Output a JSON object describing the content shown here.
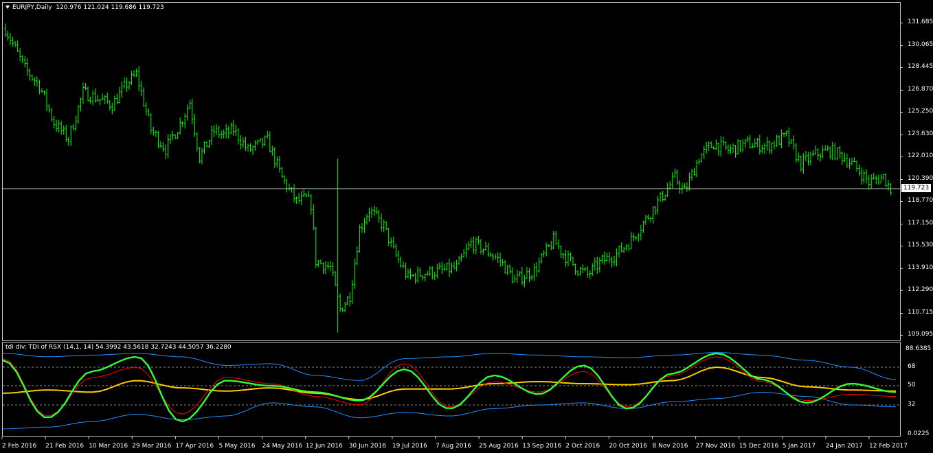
{
  "main_chart": {
    "header": {
      "symbol": "EURJPY,Daily",
      "ohlc": "120.976 121.024 119.686 119.723"
    },
    "current_price": "119.723",
    "price_axis": [
      "131.685",
      "130.065",
      "128.445",
      "126.870",
      "125.250",
      "123.630",
      "122.010",
      "120.390",
      "118.770",
      "117.150",
      "115.530",
      "113.910",
      "112.290",
      "110.715",
      "109.095"
    ],
    "bar_color": "#00ff00",
    "current_line_color": "#98b49a"
  },
  "indicator": {
    "header": "tdi div: TDI of RSX (14,1, 14) 54.3992 43.5618 32.7243 44.5057 36.2280",
    "axis": [
      "88.6385",
      "68",
      "50",
      "32",
      "0.0225"
    ],
    "colors": {
      "bands": "#1e90ff",
      "signal": "#ff0000",
      "rsx": "#32ff32",
      "midline": "#ffcc00"
    }
  },
  "time_axis": [
    "2 Feb 2016",
    "21 Feb 2016",
    "10 Mar 2016",
    "29 Mar 2016",
    "17 Apr 2016",
    "5 May 2016",
    "24 May 2016",
    "12 Jun 2016",
    "30 Jun 2016",
    "19 Jul 2016",
    "7 Aug 2016",
    "25 Aug 2016",
    "13 Sep 2016",
    "2 Oct 2016",
    "20 Oct 2016",
    "8 Nov 2016",
    "27 Nov 2016",
    "15 Dec 2016",
    "5 Jan 2017",
    "24 Jan 2017",
    "12 Feb 2017"
  ],
  "chart_data": [
    {
      "type": "line",
      "title": "EURJPY,Daily",
      "subtitle": "120.976 121.024 119.686 119.723",
      "x": [
        "2 Feb 2016",
        "21 Feb 2016",
        "10 Mar 2016",
        "29 Mar 2016",
        "17 Apr 2016",
        "5 May 2016",
        "24 May 2016",
        "12 Jun 2016",
        "30 Jun 2016",
        "19 Jul 2016",
        "7 Aug 2016",
        "25 Aug 2016",
        "13 Sep 2016",
        "2 Oct 2016",
        "20 Oct 2016",
        "8 Nov 2016",
        "27 Nov 2016",
        "15 Dec 2016",
        "5 Jan 2017",
        "24 Jan 2017",
        "12 Feb 2017"
      ],
      "series": [
        {
          "name": "",
          "values": [
            131.0,
            123.5,
            126.4,
            127.1,
            122.5,
            123.7,
            122.8,
            118.3,
            112.6,
            116.9,
            113.2,
            115.3,
            113.1,
            116.2,
            113.9,
            116.0,
            121.8,
            122.3,
            123.0,
            122.1,
            120.6
          ]
        }
      ],
      "ylim": [
        109.095,
        132.4
      ]
    },
    {
      "type": "line",
      "title": "tdi div: TDI of RSX (14,1, 14) 54.3992 43.5618 32.7243 44.5057 36.2280",
      "x": [
        "2 Feb 2016",
        "21 Feb 2016",
        "10 Mar 2016",
        "29 Mar 2016",
        "17 Apr 2016",
        "5 May 2016",
        "24 May 2016",
        "12 Jun 2016",
        "30 Jun 2016",
        "19 Jul 2016",
        "7 Aug 2016",
        "25 Aug 2016",
        "13 Sep 2016",
        "2 Oct 2016",
        "20 Oct 2016",
        "8 Nov 2016",
        "27 Nov 2016",
        "15 Dec 2016",
        "5 Jan 2017",
        "24 Jan 2017",
        "12 Feb 2017"
      ],
      "series": [
        {
          "name": "",
          "values": [
            76,
            18,
            64,
            80,
            14,
            55,
            50,
            44,
            36,
            66,
            28,
            60,
            42,
            70,
            28,
            62,
            84,
            56,
            34,
            52,
            44
          ]
        },
        {
          "name": "",
          "values": [
            78,
            20,
            58,
            68,
            22,
            58,
            52,
            40,
            32,
            72,
            30,
            54,
            44,
            64,
            30,
            60,
            80,
            54,
            36,
            42,
            40
          ]
        },
        {
          "name": "",
          "values": [
            43,
            46,
            44,
            55,
            48,
            45,
            48,
            43,
            37,
            47,
            47,
            52,
            54,
            52,
            51,
            55,
            68,
            58,
            49,
            46,
            45
          ]
        },
        {
          "name": "",
          "values": [
            84,
            80,
            82,
            84,
            80,
            70,
            72,
            60,
            55,
            78,
            80,
            84,
            82,
            80,
            79,
            82,
            85,
            82,
            76,
            68,
            56
          ]
        },
        {
          "name": "",
          "values": [
            6,
            8,
            14,
            22,
            16,
            20,
            34,
            30,
            18,
            24,
            20,
            28,
            32,
            34,
            28,
            35,
            38,
            44,
            40,
            32,
            30
          ]
        }
      ],
      "ylim": [
        0.0225,
        88.6385
      ],
      "levels": [
        32,
        50,
        68
      ]
    }
  ]
}
